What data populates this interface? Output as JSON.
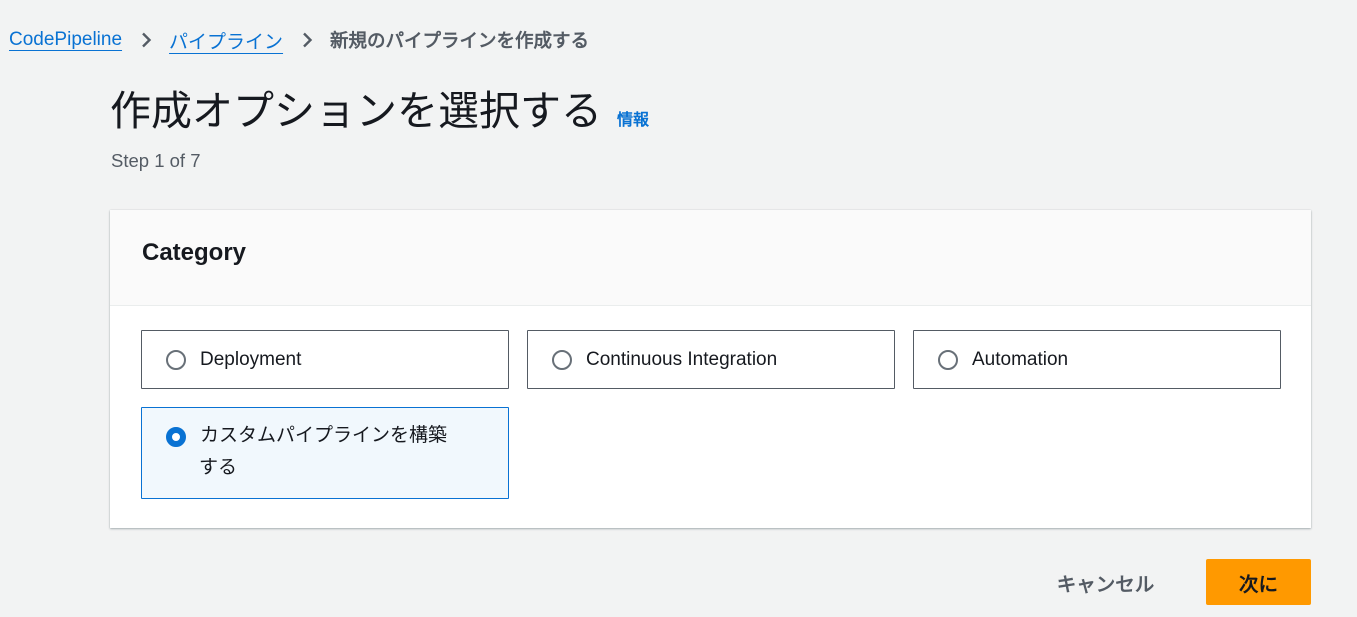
{
  "breadcrumb": {
    "items": [
      {
        "label": "CodePipeline"
      },
      {
        "label": "パイプライン"
      }
    ],
    "current": "新規のパイプラインを作成する",
    "separator_icon": "chevron-right-icon"
  },
  "header": {
    "title": "作成オプションを選択する",
    "info_link": "情報",
    "step": "Step 1 of 7"
  },
  "category": {
    "heading": "Category",
    "options": [
      {
        "label": "Deployment",
        "selected": false
      },
      {
        "label": "Continuous Integration",
        "selected": false
      },
      {
        "label": "Automation",
        "selected": false
      },
      {
        "label_line1": "カスタムパイプラインを構築",
        "label_line2": "する",
        "selected": true
      }
    ]
  },
  "footer": {
    "cancel_label": "キャンセル",
    "next_label": "次に"
  },
  "colors": {
    "link": "#0972d3",
    "primary_button": "#ff9900",
    "selected_tile_bg": "#f1f8fd",
    "page_bg": "#f2f3f3"
  }
}
